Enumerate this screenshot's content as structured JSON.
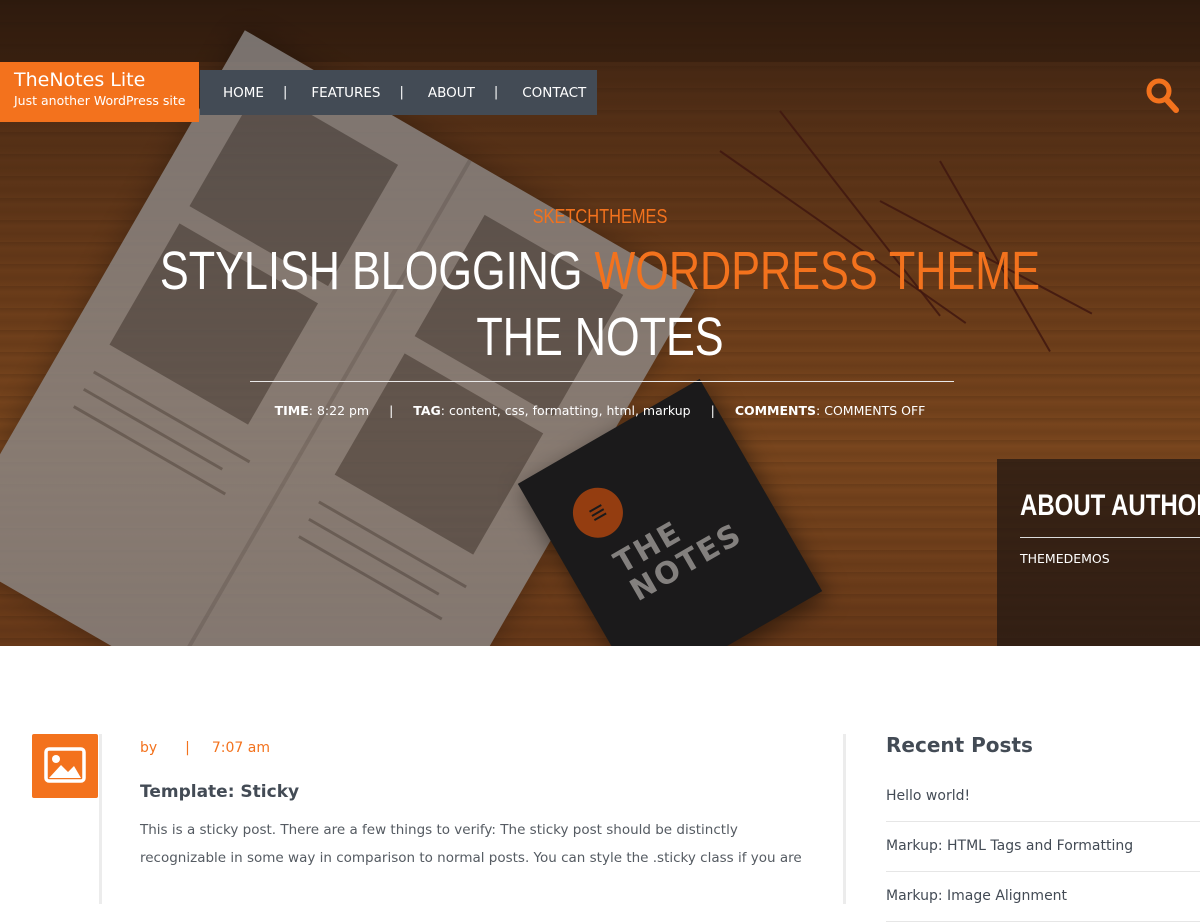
{
  "site": {
    "title": "TheNotes Lite",
    "tagline": "Just another WordPress site"
  },
  "nav": {
    "items": [
      "HOME",
      "FEATURES",
      "ABOUT",
      "CONTACT"
    ],
    "separator": "|"
  },
  "hero": {
    "kicker": "SKETCHTHEMES",
    "title_white": "STYLISH BLOGGING",
    "title_accent": "WORDPRESS THEME",
    "title_line2": "THE NOTES",
    "notebook_text_1": "THE",
    "notebook_text_2": "NOTES",
    "meta": {
      "time_label": "TIME",
      "time_value": ": 8:22 pm",
      "tag_label": "TAG",
      "tag_value": ": content, css, formatting, html, markup",
      "comments_label": "COMMENTS",
      "comments_value": ": COMMENTS OFF",
      "separator": "|"
    }
  },
  "author": {
    "heading": "ABOUT AUTHOR",
    "name": "THEMEDEMOS"
  },
  "post": {
    "by": "by",
    "separator": "|",
    "time": "7:07 am",
    "title": "Template: Sticky",
    "excerpt": "This is a sticky post. There are a few things to verify: The sticky post should be distinctly recognizable in some way in comparison to normal posts. You can style the .sticky class if you are",
    "icon": "image-icon"
  },
  "sidebar": {
    "heading": "Recent Posts",
    "items": [
      "Hello world!",
      "Markup: HTML Tags and Formatting",
      "Markup: Image Alignment"
    ]
  },
  "colors": {
    "accent": "#f3721d",
    "nav_bg": "#434b55",
    "text_dark": "#434b55"
  }
}
